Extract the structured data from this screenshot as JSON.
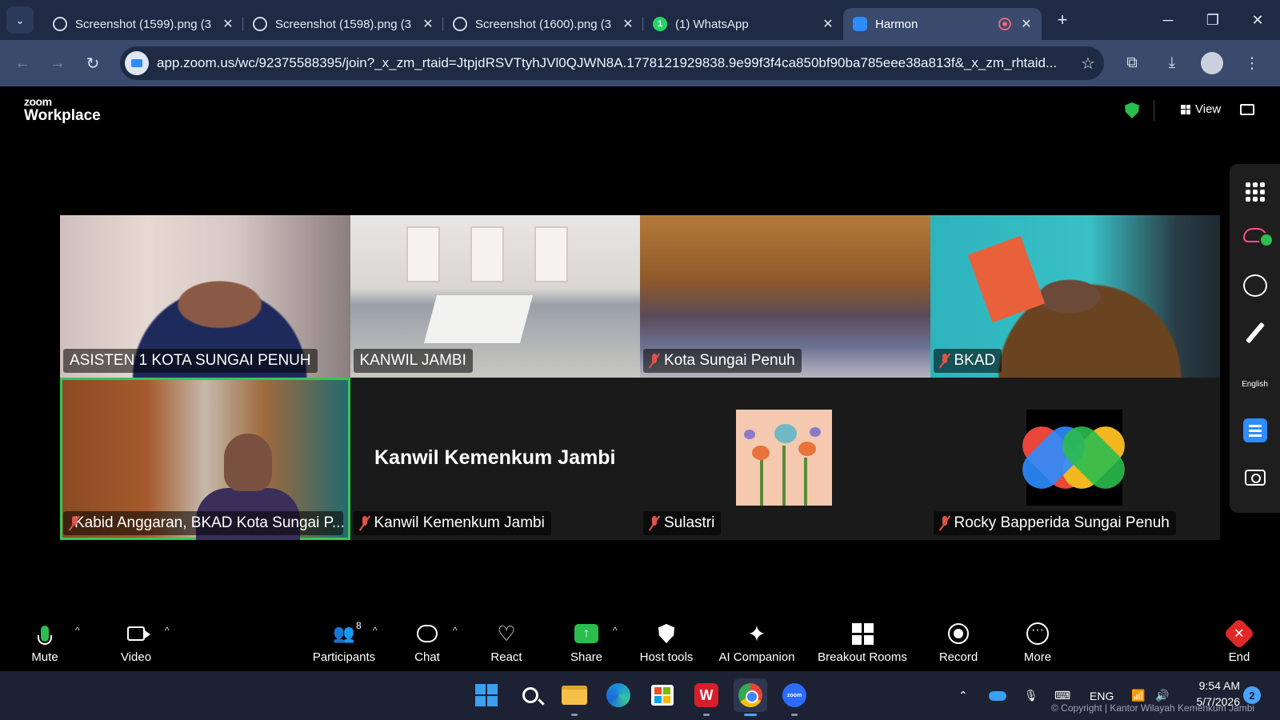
{
  "browser": {
    "tabs": [
      {
        "title": "Screenshot (1599).png (3",
        "favicon": "globe-icon",
        "active": false
      },
      {
        "title": "Screenshot (1598).png (3",
        "favicon": "globe-icon",
        "active": false
      },
      {
        "title": "Screenshot (1600).png (3",
        "favicon": "globe-icon",
        "active": false
      },
      {
        "title": "(1) WhatsApp",
        "favicon": "whatsapp-icon",
        "badge": "1",
        "active": false
      },
      {
        "title": "Harmon",
        "favicon": "zoom-icon",
        "active": true
      }
    ],
    "url": "app.zoom.us/wc/92375588395/join?_x_zm_rtaid=JtpjdRSVTtyhJVl0QJWN8A.1778121929838.9e99f3f4ca850bf90ba785eee38a813f&_x_zm_rhtaid..."
  },
  "zoom": {
    "logo_small": "zoom",
    "logo_big": "Workplace",
    "view_label": "View",
    "participants": [
      {
        "name": "ASISTEN 1 KOTA SUNGAI PENUH",
        "muted": false
      },
      {
        "name": "KANWIL JAMBI",
        "muted": false
      },
      {
        "name": "Kota Sungai Penuh",
        "muted": true
      },
      {
        "name": "BKAD",
        "muted": true
      },
      {
        "name": "Kabid Anggaran, BKAD Kota Sungai P...",
        "muted": true,
        "active_speaker": true
      },
      {
        "name": "Kanwil Kemenkum Jambi",
        "display_name": "Kanwil Kemenkum Jambi",
        "muted": true
      },
      {
        "name": "Sulastri",
        "muted": true
      },
      {
        "name": "Rocky Bapperida Sungai Penuh",
        "muted": true
      }
    ],
    "sidebar": {
      "language": "English"
    },
    "toolbar": {
      "mute": "Mute",
      "video": "Video",
      "participants": "Participants",
      "participant_count": "8",
      "chat": "Chat",
      "react": "React",
      "share": "Share",
      "host_tools": "Host tools",
      "ai_companion": "AI Companion",
      "breakout_rooms": "Breakout Rooms",
      "record": "Record",
      "more": "More",
      "end": "End"
    }
  },
  "taskbar": {
    "language": "ENG",
    "time": "9:54 AM",
    "date": "5/7/2026",
    "notifications": "2",
    "watermark": "© Copyright | Kantor Wilayah Kemenkum Jambi"
  }
}
